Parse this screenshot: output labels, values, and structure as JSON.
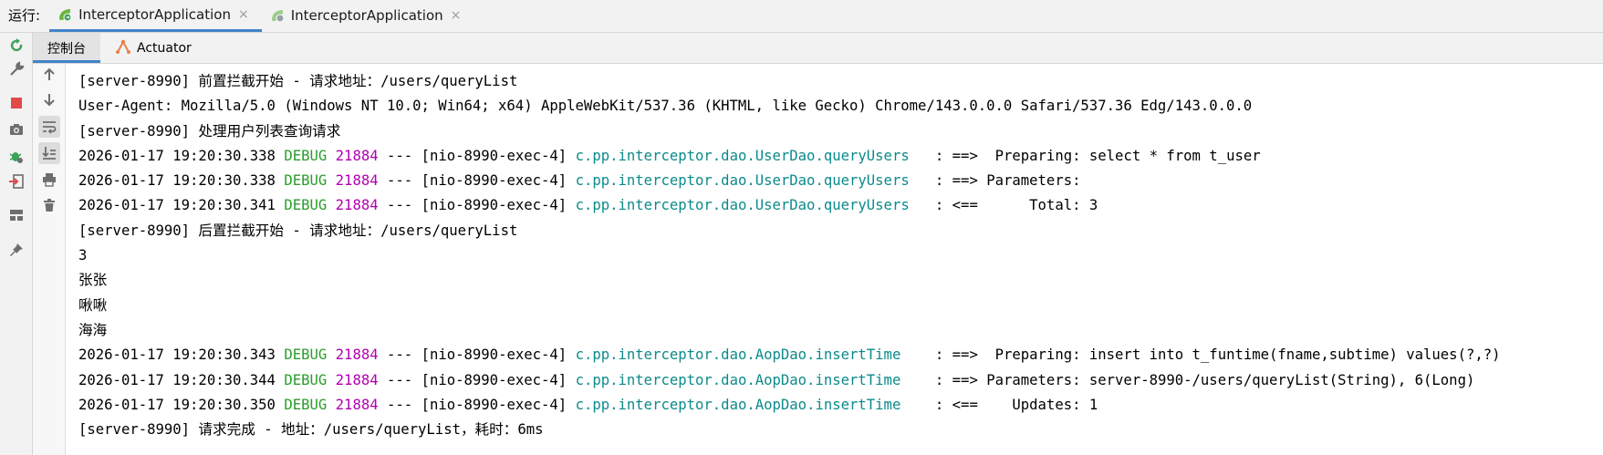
{
  "runbar": {
    "label": "运行:",
    "tabs": [
      {
        "label": "InterceptorApplication",
        "close": "×",
        "active": true
      },
      {
        "label": "InterceptorApplication",
        "close": "×",
        "active": false
      }
    ]
  },
  "subtabs": [
    {
      "label": "控制台",
      "active": true
    },
    {
      "label": "Actuator",
      "active": false
    }
  ],
  "console": {
    "lines": [
      {
        "type": "plain",
        "text": "[server-8990] 前置拦截开始 - 请求地址：/users/queryList"
      },
      {
        "type": "plain",
        "text": "User-Agent: Mozilla/5.0 (Windows NT 10.0; Win64; x64) AppleWebKit/537.36 (KHTML, like Gecko) Chrome/143.0.0.0 Safari/537.36 Edg/143.0.0.0"
      },
      {
        "type": "plain",
        "text": "[server-8990] 处理用户列表查询请求"
      },
      {
        "type": "log",
        "ts": "2026-01-17 19:20:30.338",
        "level": "DEBUG",
        "pid": "21884",
        "sep": " --- ",
        "thread": "[nio-8990-exec-4]",
        "logger": "c.pp.interceptor.dao.UserDao.queryUsers  ",
        "msg": " : ==>  Preparing: select * from t_user"
      },
      {
        "type": "log",
        "ts": "2026-01-17 19:20:30.338",
        "level": "DEBUG",
        "pid": "21884",
        "sep": " --- ",
        "thread": "[nio-8990-exec-4]",
        "logger": "c.pp.interceptor.dao.UserDao.queryUsers  ",
        "msg": " : ==> Parameters: "
      },
      {
        "type": "log",
        "ts": "2026-01-17 19:20:30.341",
        "level": "DEBUG",
        "pid": "21884",
        "sep": " --- ",
        "thread": "[nio-8990-exec-4]",
        "logger": "c.pp.interceptor.dao.UserDao.queryUsers  ",
        "msg": " : <==      Total: 3"
      },
      {
        "type": "plain",
        "text": "[server-8990] 后置拦截开始 - 请求地址：/users/queryList"
      },
      {
        "type": "plain",
        "text": "3"
      },
      {
        "type": "plain",
        "text": "张张"
      },
      {
        "type": "plain",
        "text": "啾啾"
      },
      {
        "type": "plain",
        "text": "海海"
      },
      {
        "type": "log",
        "ts": "2026-01-17 19:20:30.343",
        "level": "DEBUG",
        "pid": "21884",
        "sep": " --- ",
        "thread": "[nio-8990-exec-4]",
        "logger": "c.pp.interceptor.dao.AopDao.insertTime   ",
        "msg": " : ==>  Preparing: insert into t_funtime(fname,subtime) values(?,?)"
      },
      {
        "type": "log",
        "ts": "2026-01-17 19:20:30.344",
        "level": "DEBUG",
        "pid": "21884",
        "sep": " --- ",
        "thread": "[nio-8990-exec-4]",
        "logger": "c.pp.interceptor.dao.AopDao.insertTime   ",
        "msg": " : ==> Parameters: server-8990-/users/queryList(String), 6(Long)"
      },
      {
        "type": "log",
        "ts": "2026-01-17 19:20:30.350",
        "level": "DEBUG",
        "pid": "21884",
        "sep": " --- ",
        "thread": "[nio-8990-exec-4]",
        "logger": "c.pp.interceptor.dao.AopDao.insertTime   ",
        "msg": " : <==    Updates: 1"
      },
      {
        "type": "plain",
        "text": "[server-8990] 请求完成 - 地址：/users/queryList，耗时：6ms"
      }
    ]
  },
  "colors": {
    "level": "#2a9d2a",
    "pid": "#b000b0",
    "logger": "#0c8a8a",
    "accent": "#4083c9",
    "stop": "#e34a4a",
    "rerun": "#3aa35a"
  },
  "icons": {
    "left_strip": [
      "rerun-icon",
      "wrench-icon",
      "stop-icon",
      "camera-icon",
      "bug-icon",
      "exit-icon",
      "layout-icon",
      "pin-icon"
    ],
    "console_toolbar": [
      "arrow-up-icon",
      "arrow-down-icon",
      "soft-wrap-icon",
      "scroll-to-end-icon",
      "print-icon",
      "trash-icon"
    ]
  }
}
